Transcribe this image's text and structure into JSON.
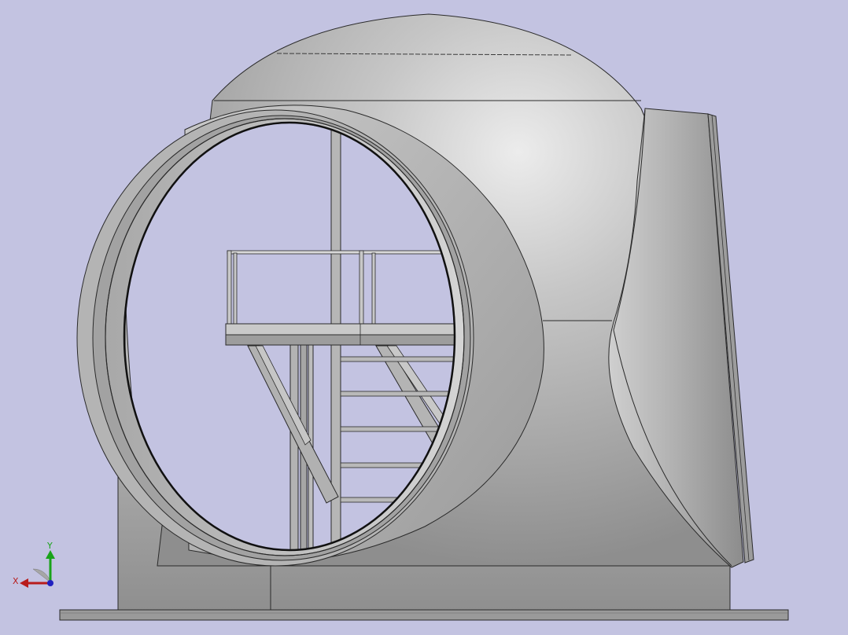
{
  "viewport": {
    "background": "#c3c3e1",
    "model": {
      "body_color": "#a9a9a9",
      "edge_color": "#1e1e1e",
      "parts": [
        "hub-shell",
        "blade-flange-opening",
        "platform",
        "ladder",
        "railing",
        "base-plate",
        "side-flange"
      ]
    },
    "triad": {
      "x_label": "X",
      "y_label": "Y",
      "x_color": "#b81c1c",
      "y_color": "#19a319",
      "z_color": "#2020c0"
    }
  }
}
